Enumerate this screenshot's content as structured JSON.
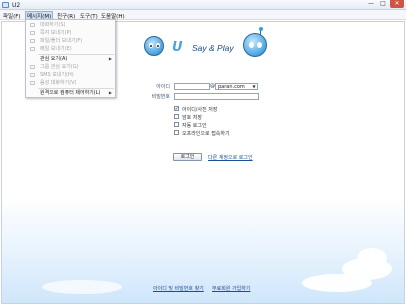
{
  "window": {
    "title": "U2",
    "minimize": "—",
    "maximize": "□",
    "close": "✕"
  },
  "menubar": [
    "파일(F)",
    "메시지(M)",
    "친구(R)",
    "도구(T)",
    "도움말(H)"
  ],
  "dropdown": {
    "items": [
      {
        "label": "대화하기(S)",
        "enabled": false,
        "submenu": false,
        "icon": "chat-icon"
      },
      {
        "label": "쪽지 보내기(P)",
        "enabled": false,
        "submenu": false,
        "icon": "note-icon"
      },
      {
        "label": "파일/폴더 보내기(F)",
        "enabled": false,
        "submenu": false,
        "icon": "folder-icon"
      },
      {
        "label": "메일 보내기(E)",
        "enabled": false,
        "submenu": false,
        "icon": "mail-icon"
      },
      {
        "label": "관심 요기(A)",
        "enabled": true,
        "submenu": true,
        "icon": ""
      },
      {
        "label": "그룹 관심 요기(G)",
        "enabled": false,
        "submenu": false,
        "icon": "group-icon"
      },
      {
        "label": "SMS 보내기(H)",
        "enabled": false,
        "submenu": false,
        "icon": "sms-icon"
      },
      {
        "label": "음성 대화하기(V)",
        "enabled": false,
        "submenu": false,
        "icon": "voice-icon"
      },
      {
        "label": "원격으로 컴퓨터 제어하기(L)",
        "enabled": true,
        "submenu": true,
        "icon": ""
      }
    ]
  },
  "logo": {
    "u": "U",
    "tagline": "Say & Play"
  },
  "login": {
    "id_label": "아이디",
    "password_label": "비밀번호",
    "id_value": "",
    "password_value": "",
    "at": "@",
    "domain": "paran.com",
    "options": [
      {
        "label": "아이디/사진 저장",
        "checked": true
      },
      {
        "label": "암호 저장",
        "checked": false
      },
      {
        "label": "자동 로그인",
        "checked": false
      },
      {
        "label": "오프라인으로 접속하기",
        "checked": false
      }
    ],
    "login_button": "로그인",
    "other_account_link": "다른 계정으로 로그인"
  },
  "footer": {
    "find_link": "아이디 및 비밀번호 찾기",
    "signup_link": "무료회원 가입하기"
  }
}
